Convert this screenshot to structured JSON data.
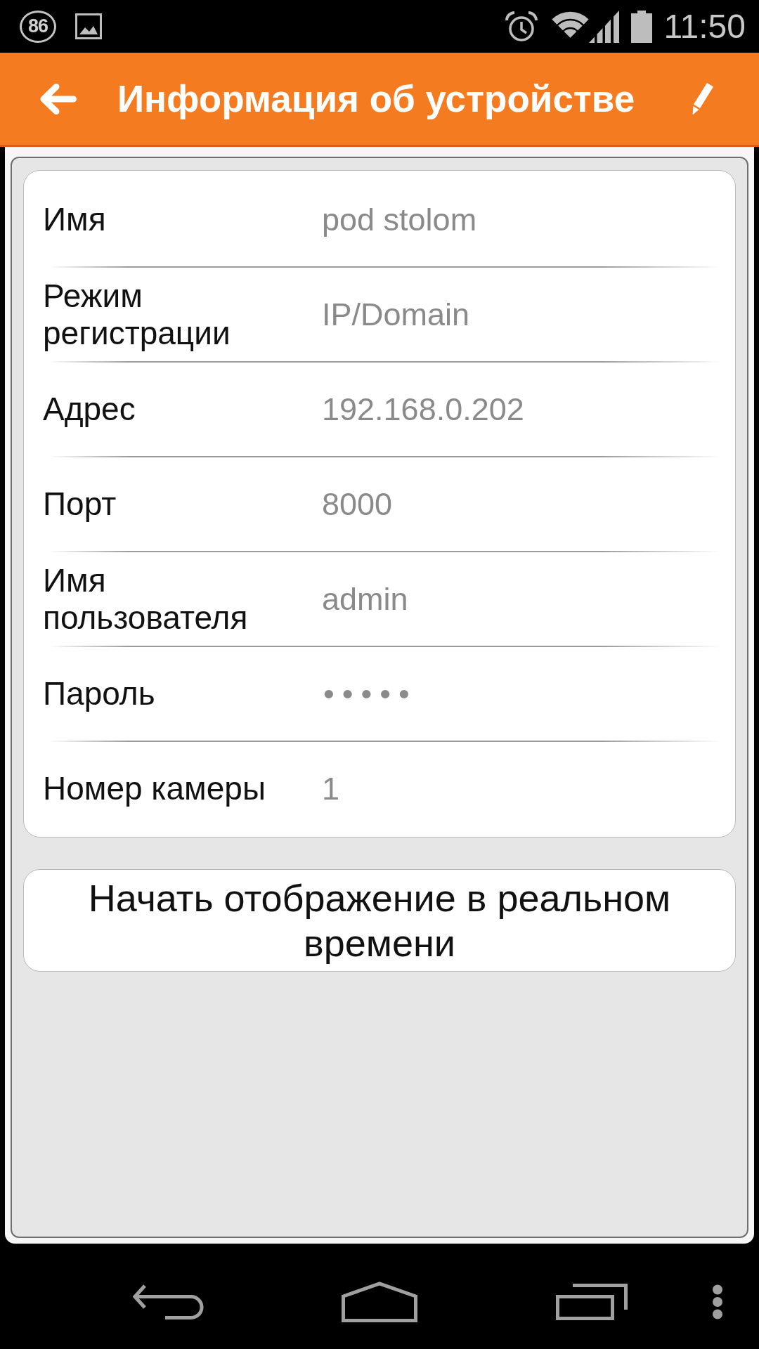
{
  "status_bar": {
    "notification_count": "86",
    "time": "11:50"
  },
  "header": {
    "title": "Информация об устройстве"
  },
  "fields": [
    {
      "label": "Имя",
      "value": "pod stolom",
      "kind": "text"
    },
    {
      "label": "Режим регистрации",
      "value": "IP/Domain",
      "kind": "text"
    },
    {
      "label": "Адрес",
      "value": "192.168.0.202",
      "kind": "text"
    },
    {
      "label": "Порт",
      "value": "8000",
      "kind": "text"
    },
    {
      "label": "Имя пользователя",
      "value": "admin",
      "kind": "text"
    },
    {
      "label": "Пароль",
      "value": "•••••",
      "kind": "password"
    },
    {
      "label": "Номер камеры",
      "value": "1",
      "kind": "text"
    }
  ],
  "primary_button": {
    "label": "Начать отображение в реальном времени"
  }
}
